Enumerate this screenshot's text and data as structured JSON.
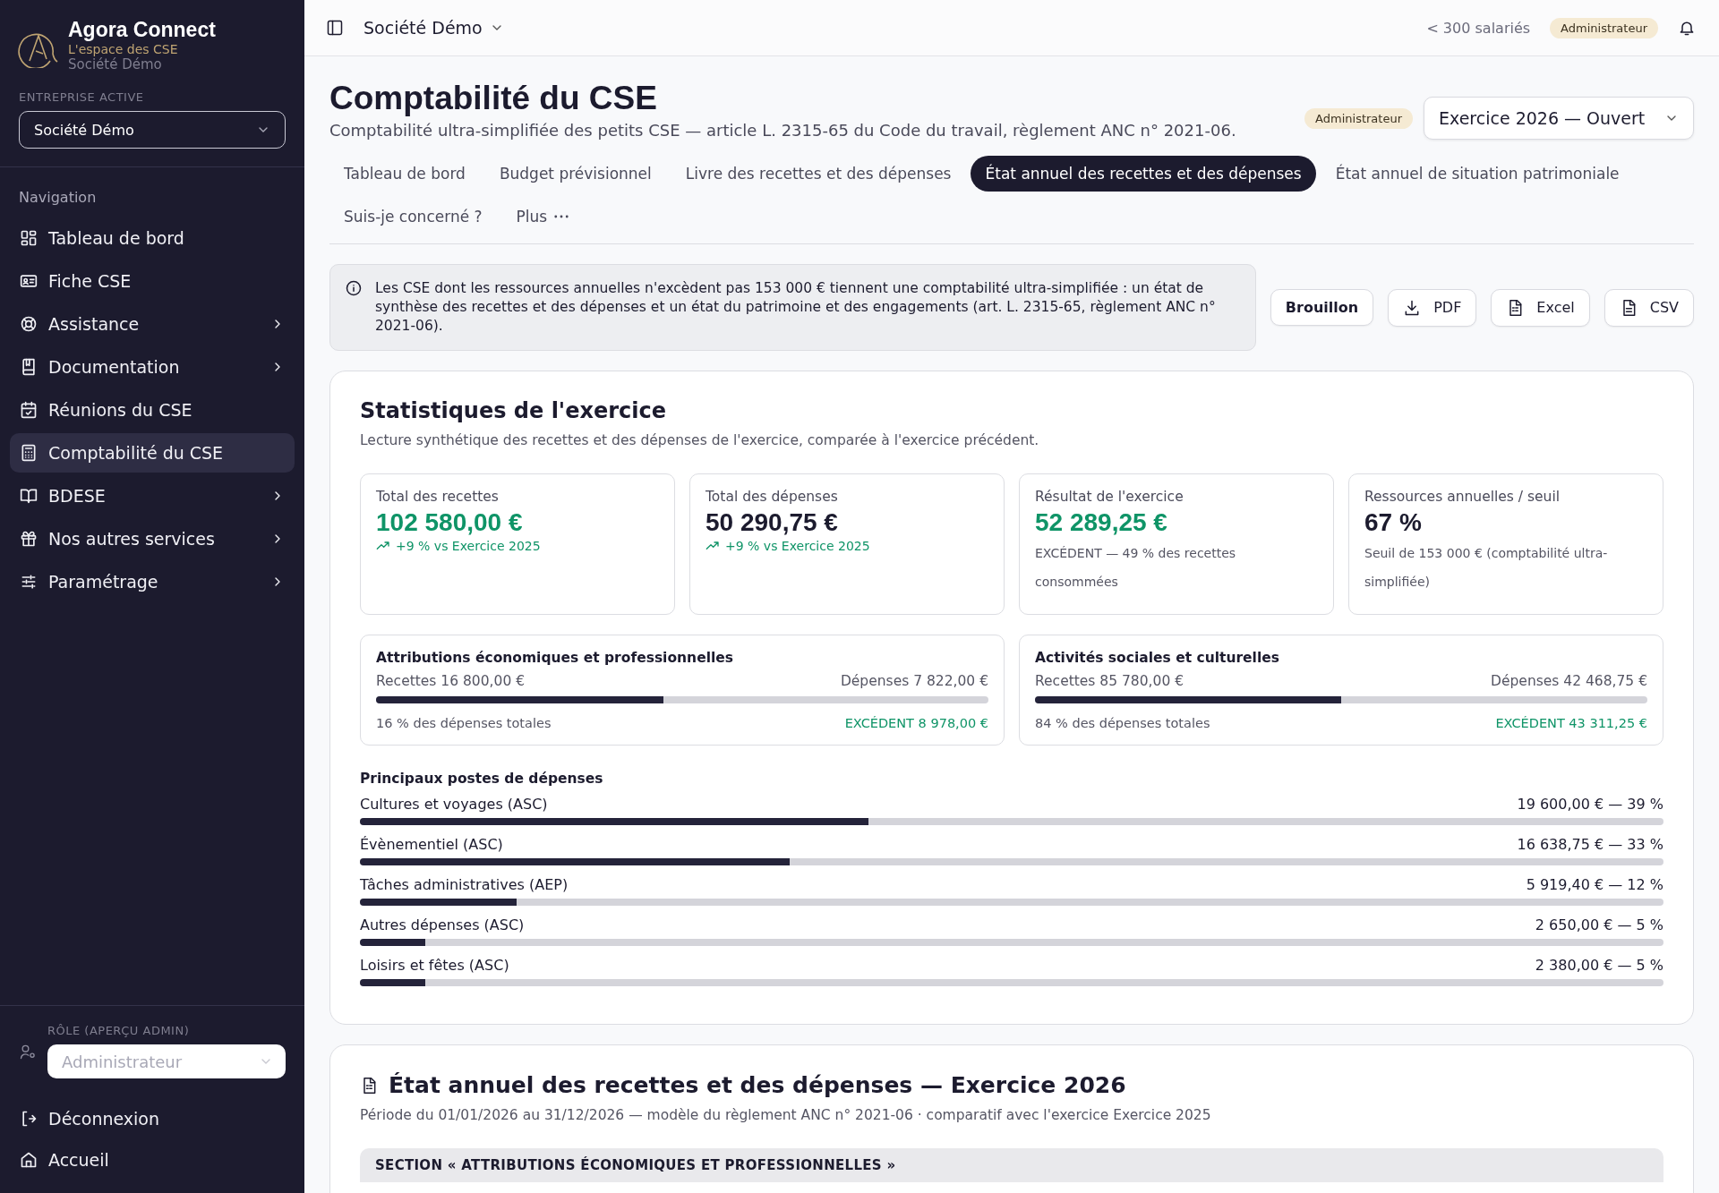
{
  "sidebar": {
    "brand": {
      "name": "Agora Connect",
      "tagline": "L'espace des CSE",
      "company": "Société Démo"
    },
    "company_picker": {
      "label": "ENTREPRISE ACTIVE",
      "value": "Société Démo"
    },
    "nav_heading": "Navigation",
    "items": [
      {
        "label": "Tableau de bord",
        "has_submenu": false,
        "selected": false
      },
      {
        "label": "Fiche CSE",
        "has_submenu": false,
        "selected": false
      },
      {
        "label": "Assistance",
        "has_submenu": true,
        "selected": false
      },
      {
        "label": "Documentation",
        "has_submenu": true,
        "selected": false
      },
      {
        "label": "Réunions du CSE",
        "has_submenu": false,
        "selected": false
      },
      {
        "label": "Comptabilité du CSE",
        "has_submenu": false,
        "selected": true
      },
      {
        "label": "BDESE",
        "has_submenu": true,
        "selected": false
      },
      {
        "label": "Nos autres services",
        "has_submenu": true,
        "selected": false
      },
      {
        "label": "Paramétrage",
        "has_submenu": true,
        "selected": false
      }
    ],
    "role_picker": {
      "label": "RÔLE (APERÇU ADMIN)",
      "placeholder": "Administrateur"
    },
    "footer_items": [
      {
        "label": "Déconnexion"
      },
      {
        "label": "Accueil"
      }
    ]
  },
  "topbar": {
    "company": "Société Démo",
    "size": "< 300 salariés",
    "role_badge": "Administrateur"
  },
  "page": {
    "title": "Comptabilité du CSE",
    "subtitle": "Comptabilité ultra-simplifiée des petits CSE — article L. 2315-65 du Code du travail, règlement ANC n° 2021-06.",
    "role_badge": "Administrateur",
    "exercise": "Exercice 2026 — Ouvert",
    "tabs": [
      {
        "label": "Tableau de bord",
        "selected": false
      },
      {
        "label": "Budget prévisionnel",
        "selected": false
      },
      {
        "label": "Livre des recettes et des dépenses",
        "selected": false
      },
      {
        "label": "État annuel des recettes et des dépenses",
        "selected": true
      },
      {
        "label": "État annuel de situation patrimoniale",
        "selected": false
      },
      {
        "label": "Suis-je concerné ?",
        "selected": false
      },
      {
        "label": "Plus",
        "selected": false
      }
    ],
    "notice": "Les CSE dont les ressources annuelles n'excèdent pas 153 000 € tiennent une comptabilité ultra-simplifiée : un état de synthèse des recettes et des dépenses et un état du patrimoine et des engagements (art. L. 2315-65, règlement ANC n° 2021-06).",
    "status": "Brouillon",
    "exports": [
      {
        "label": "PDF"
      },
      {
        "label": "Excel"
      },
      {
        "label": "CSV"
      }
    ]
  },
  "stats": {
    "title": "Statistiques de l'exercice",
    "subtitle": "Lecture synthétique des recettes et des dépenses de l'exercice, comparée à l'exercice précédent.",
    "kpis": [
      {
        "label": "Total des recettes",
        "value": "102 580,00 €",
        "positive": true,
        "trend": "+9 % vs Exercice 2025"
      },
      {
        "label": "Total des dépenses",
        "value": "50 290,75 €",
        "positive": false,
        "trend": "+9 % vs Exercice 2025"
      },
      {
        "label": "Résultat de l'exercice",
        "value": "52 289,25 €",
        "positive": true,
        "note": "EXCÉDENT — 49 % des recettes consommées"
      },
      {
        "label": "Ressources annuelles / seuil",
        "value": "67 %",
        "positive": false,
        "note": "Seuil de 153 000 € (comptabilité ultra-simplifiée)"
      }
    ],
    "categories": [
      {
        "title": "Attributions économiques et professionnelles",
        "income": "Recettes 16 800,00 €",
        "expense": "Dépenses 7 822,00 €",
        "level": 0.47,
        "share": "16 % des dépenses totales",
        "result": "EXCÉDENT 8 978,00 €"
      },
      {
        "title": "Activités sociales et culturelles",
        "income": "Recettes 85 780,00 €",
        "expense": "Dépenses 42 468,75 €",
        "level": 0.5,
        "share": "84 % des dépenses totales",
        "result": "EXCÉDENT 43 311,25 €"
      }
    ],
    "top_expenses": {
      "title": "Principaux postes de dépenses",
      "items": [
        {
          "label": "Cultures et voyages (ASC)",
          "amount": "19 600,00 € — 39 %",
          "level": 0.39
        },
        {
          "label": "Évènementiel (ASC)",
          "amount": "16 638,75 € — 33 %",
          "level": 0.33
        },
        {
          "label": "Tâches administratives (AEP)",
          "amount": "5 919,40 € — 12 %",
          "level": 0.12
        },
        {
          "label": "Autres dépenses (ASC)",
          "amount": "2 650,00 € — 5 %",
          "level": 0.05
        },
        {
          "label": "Loisirs et fêtes (ASC)",
          "amount": "2 380,00 € — 5 %",
          "level": 0.05
        }
      ]
    }
  },
  "statement": {
    "title": "État annuel des recettes et des dépenses — Exercice 2026",
    "subtitle": "Période du 01/01/2026 au 31/12/2026 — modèle du règlement ANC n° 2021-06 · comparatif avec l'exercice Exercice 2025",
    "section_header": "SECTION « ATTRIBUTIONS ÉCONOMIQUES ET PROFESSIONNELLES »"
  }
}
